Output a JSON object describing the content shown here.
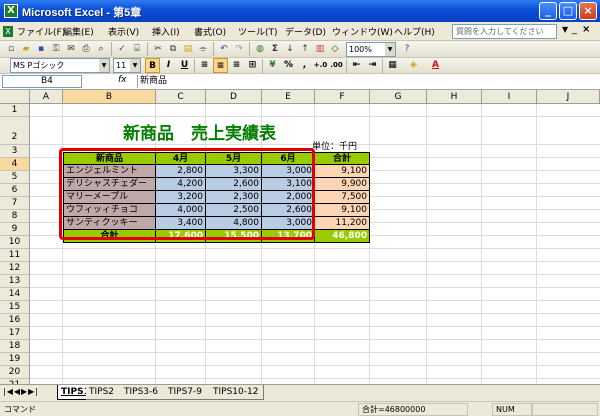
{
  "window": {
    "title": "Microsoft Excel - 第5章",
    "app_icon": "excel-x-icon"
  },
  "menu": {
    "items": [
      "ファイル(F)",
      "編集(E)",
      "表示(V)",
      "挿入(I)",
      "書式(O)",
      "ツール(T)",
      "データ(D)",
      "ウィンドウ(W)",
      "ヘルプ(H)"
    ],
    "help_placeholder": "質問を入力してください"
  },
  "toolbar": {
    "zoom": "100%",
    "font_name": "MS Pゴシック",
    "font_size": "11",
    "bold": "B",
    "italic": "I",
    "underline": "U",
    "percent": "%",
    "comma": ",",
    "sigma": "Σ"
  },
  "formula_bar": {
    "name_box": "B4",
    "fx": "fx",
    "content": "新商品"
  },
  "columns": [
    "A",
    "B",
    "C",
    "D",
    "E",
    "F",
    "G",
    "H",
    "I",
    "J"
  ],
  "rows": [
    "1",
    "2",
    "3",
    "4",
    "5",
    "6",
    "7",
    "8",
    "9",
    "10",
    "11",
    "12",
    "13",
    "14",
    "15",
    "16",
    "17",
    "18",
    "19",
    "20",
    "21"
  ],
  "sheet": {
    "title": "新商品　売上実績表",
    "unit": "単位：千円",
    "headers": [
      "新商品",
      "4月",
      "5月",
      "6月",
      "合計"
    ],
    "data": [
      [
        "エンジェルミント",
        "2,800",
        "3,300",
        "3,000",
        "9,100"
      ],
      [
        "デリシャスチェダー",
        "4,200",
        "2,600",
        "3,100",
        "9,900"
      ],
      [
        "マリーメープル",
        "3,200",
        "2,300",
        "2,000",
        "7,500"
      ],
      [
        "ウフィッィチョコ",
        "4,000",
        "2,500",
        "2,600",
        "9,100"
      ],
      [
        "サンティクッキー",
        "3,400",
        "4,800",
        "3,000",
        "11,200"
      ]
    ],
    "total": [
      "合計",
      "17,600",
      "15,500",
      "13,700",
      "46,800"
    ]
  },
  "tabs": [
    "TIPS1",
    "TIPS2",
    "TIPS3-6",
    "TIPS7-9",
    "TIPS10-12"
  ],
  "status": {
    "mode": "コマンド",
    "sum": "合計=46800000",
    "num": "NUM"
  },
  "colors": {
    "title_green": "#008000",
    "header_green": "#99cc00",
    "name_fill": "#c0a8a8",
    "data_fill": "#b8cce4",
    "total_fill": "#fcd5b4",
    "highlight_red": "#e00000"
  }
}
